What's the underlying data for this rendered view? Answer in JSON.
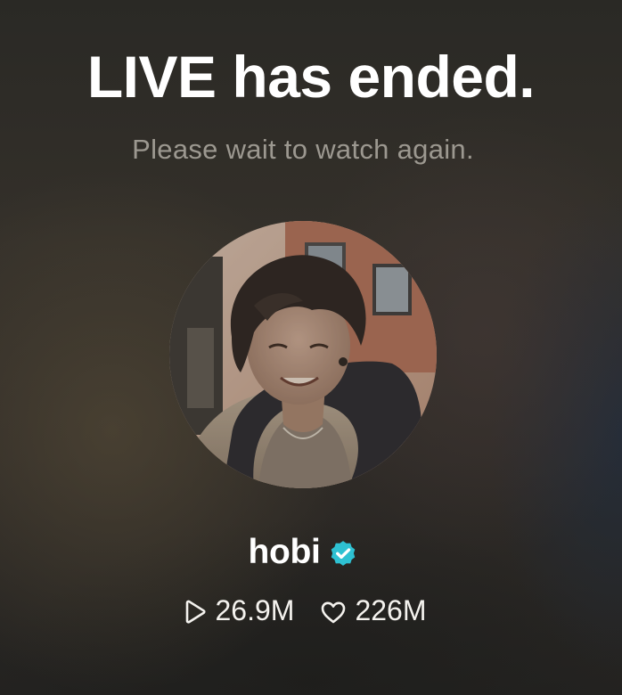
{
  "screen": {
    "title": "LIVE has ended.",
    "subtitle": "Please wait to watch again."
  },
  "profile": {
    "avatar_icon": "avatar",
    "name": "hobi",
    "verified_icon": "verified-badge-icon",
    "verified_color": "#2ec1d2"
  },
  "stats": {
    "plays": {
      "icon": "play-icon",
      "value": "26.9M"
    },
    "likes": {
      "icon": "heart-icon",
      "value": "226M"
    }
  }
}
